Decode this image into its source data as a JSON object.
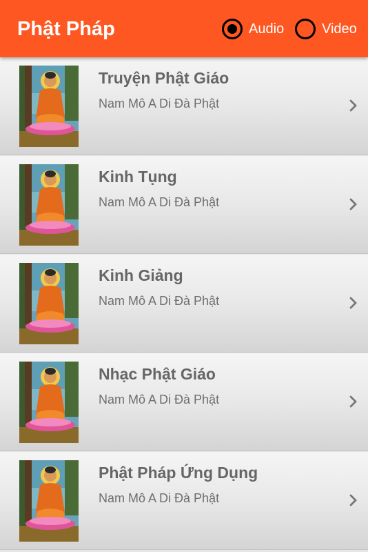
{
  "app": {
    "title": "Phật Pháp",
    "accent_color": "#ff5722"
  },
  "media_toggle": {
    "options": [
      {
        "label": "Audio",
        "selected": true
      },
      {
        "label": "Video",
        "selected": false
      }
    ]
  },
  "list": {
    "items": [
      {
        "title": "Truyện Phật Giáo",
        "subtitle": "Nam Mô A Di Đà Phật",
        "thumbnail": "buddha-image",
        "trailing_icon": "chevron-right-icon"
      },
      {
        "title": "Kinh Tụng",
        "subtitle": "Nam Mô A Di Đà Phật",
        "thumbnail": "buddha-image",
        "trailing_icon": "chevron-right-icon"
      },
      {
        "title": "Kinh Giảng",
        "subtitle": "Nam Mô A Di Đà Phật",
        "thumbnail": "buddha-image",
        "trailing_icon": "chevron-right-icon"
      },
      {
        "title": "Nhạc Phật Giáo",
        "subtitle": "Nam Mô A Di Đà Phật",
        "thumbnail": "buddha-image",
        "trailing_icon": "chevron-right-icon"
      },
      {
        "title": "Phật Pháp Ứng Dụng",
        "subtitle": "Nam Mô A Di Đà Phật",
        "thumbnail": "buddha-image",
        "trailing_icon": "chevron-right-icon"
      }
    ]
  }
}
